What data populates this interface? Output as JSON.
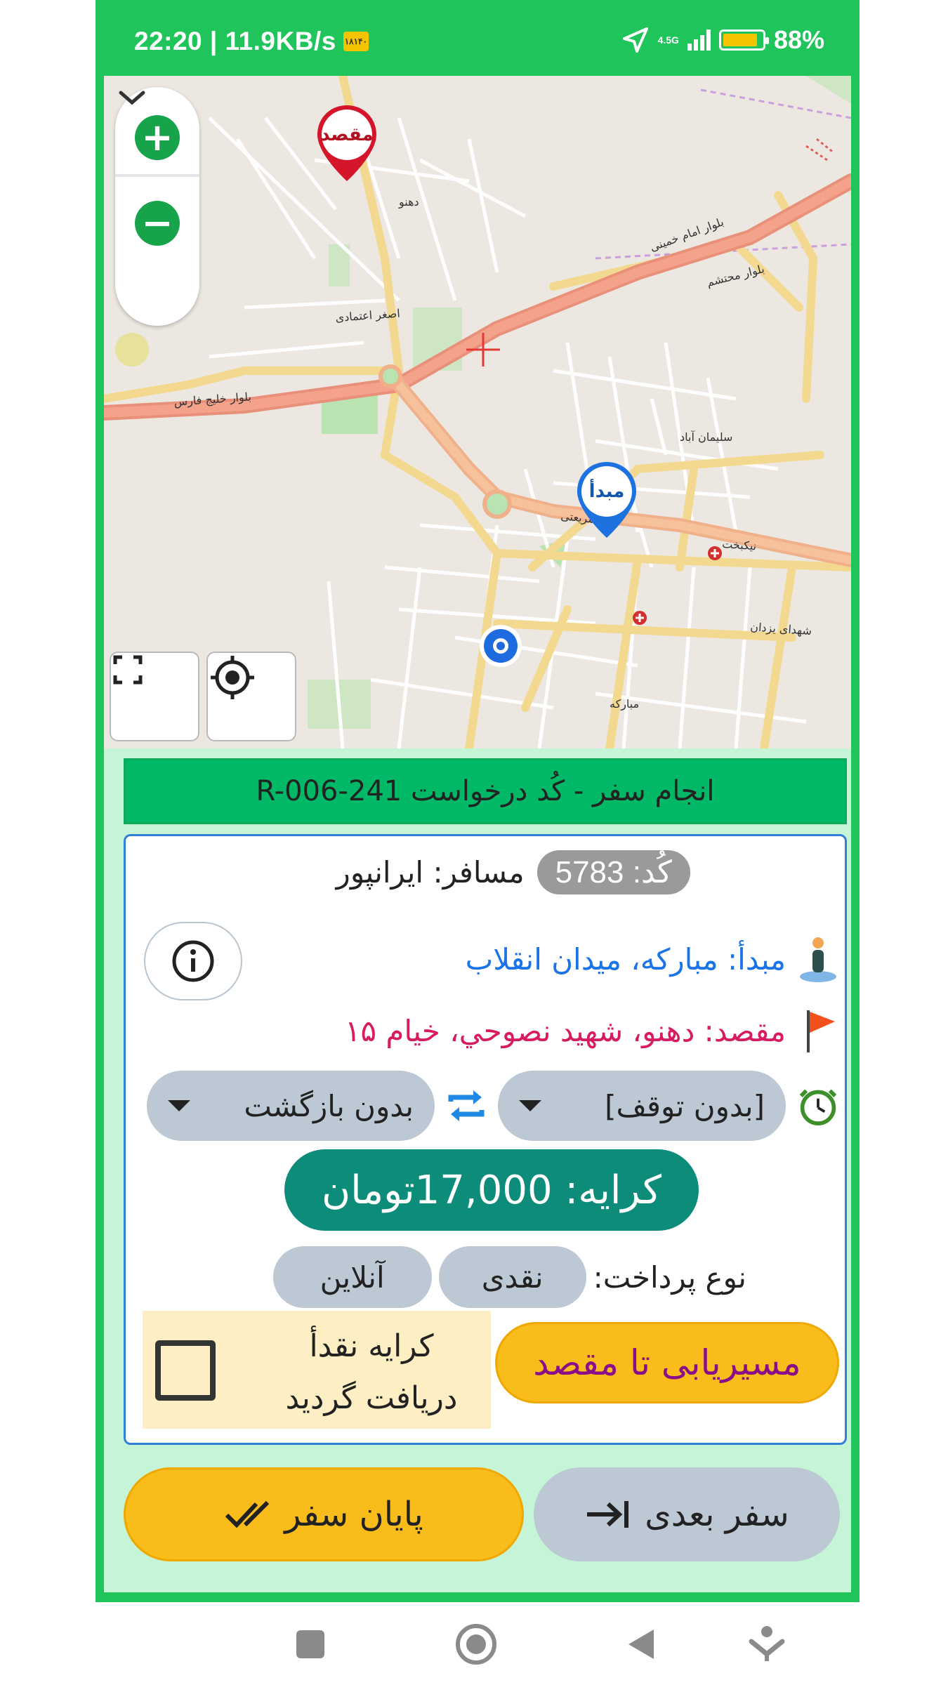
{
  "status_bar": {
    "time_speed": "22:20 | 11.9KB/s",
    "sim_badge": "۱۸۱۴۰",
    "network": "4.5G",
    "battery": "88%",
    "battery_level": 0.88
  },
  "map": {
    "zoom_in_label": "+",
    "zoom_out_label": "−",
    "destination_pin": "مقصد",
    "origin_pin": "مبدأ",
    "street_labels": {
      "blvd_khomeini": "بلوار امام خمینی",
      "blvd_persian_gulf": "بلوار خلیج فارس",
      "blvd_mohtasham": "بلوار محتشم",
      "shariati": "شریعتی",
      "niknakht": "نیکبخت",
      "mobarakeh": "مبارکه",
      "dehno": "دهنو",
      "soleimanabad": "سلیمان آباد",
      "shohada_yazdan": "شهدای یزدان",
      "asghar_etemadi": "اصغر اعتمادی"
    }
  },
  "header": {
    "title": "انجام سفر - کُد درخواست R-006-241"
  },
  "trip": {
    "code_label": "کُد: 5783",
    "passenger_label": "مسافر: ایرانپور",
    "origin_label": "مبدأ: مبارکه، میدان انقلاب",
    "destination_label": "مقصد: دهنو، شهید نصوحي، خيام ١۵",
    "stop_select": "[بدون توقف]",
    "return_select": "بدون بازگشت",
    "fare_label": "کرایه: 17,000تومان",
    "payment_type_label": "نوع پرداخت:",
    "payment_cash": "نقدی",
    "payment_online": "آنلاین",
    "route_button": "مسیریابی تا مقصد",
    "cash_received_line1": "کرایه نقدأ",
    "cash_received_line2": "دریافت گردید",
    "cash_received_checked": false
  },
  "actions": {
    "end_trip": "پایان سفر",
    "next_trip": "سفر بعدی"
  },
  "colors": {
    "app_green": "#1fc45a",
    "header_green": "#00b866",
    "fare_teal": "#0e8c7a",
    "button_yellow": "#f9bd1b",
    "pill_gray": "#bcc9d5",
    "origin_blue": "#1a73e8",
    "destination_pink": "#d81b60"
  },
  "icons": {
    "status": [
      "location-arrow-icon",
      "signal-bars-icon",
      "battery-icon"
    ],
    "card": [
      "info-icon",
      "person-pin-icon",
      "red-flag-icon",
      "stopwatch-icon",
      "swap-arrows-icon"
    ],
    "buttons": [
      "double-check-icon",
      "arrow-to-right-icon"
    ],
    "nav": [
      "square-icon",
      "home-circle-icon",
      "back-triangle-icon",
      "notification-down-icon"
    ]
  }
}
